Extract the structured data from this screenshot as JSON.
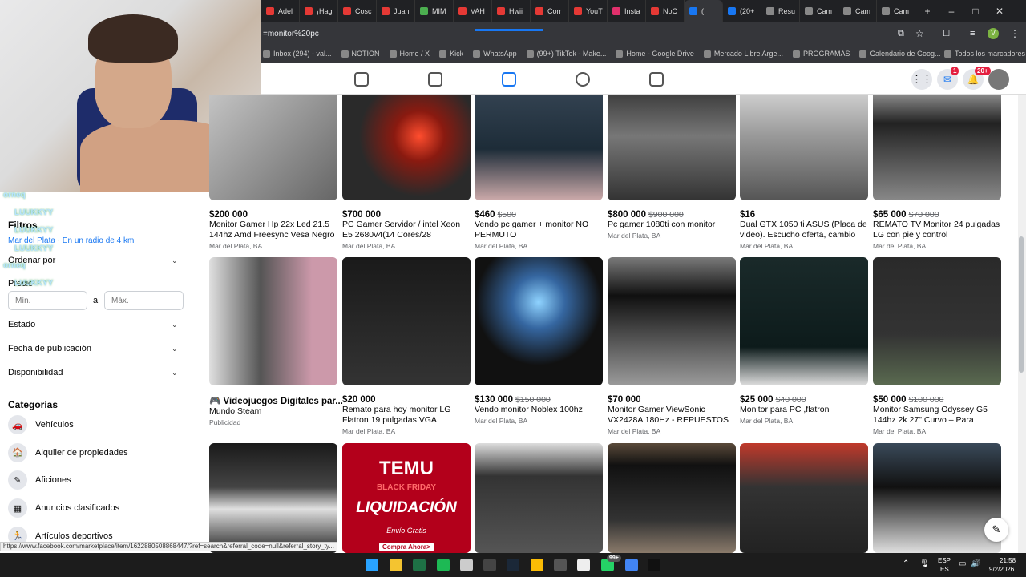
{
  "browser": {
    "tabs": [
      "Adel",
      "¡Hag",
      "Cosc",
      "Juan",
      "MIM",
      "VAH",
      "Hwii",
      "Corr",
      "YouT",
      "Insta",
      "NoC",
      "(",
      "(20+",
      "Resu",
      "Cam",
      "Cam",
      "Cam"
    ],
    "url": "=monitor%20pc",
    "bookmarks": [
      "Inbox (294) - val...",
      "NOTION",
      "Home / X",
      "Kick",
      "WhatsApp",
      "(99+) TikTok - Make...",
      "Home - Google Drive",
      "Mercado Libre Arge...",
      "PROGRAMAS",
      "Calendario de Goog..."
    ],
    "all_bookmarks": "Todos los marcadores",
    "profile_letter": "V",
    "status_url": "https://www.facebook.com/marketplace/item/1622880508868447/?ref=search&referral_code=null&referral_story_ty..."
  },
  "fbnav": {
    "messenger_badge": "1",
    "notif_badge": "20+"
  },
  "chat": {
    "user1": "orneq",
    "user2": "LUUKKYY"
  },
  "sidebar": {
    "filters": "Filtros",
    "location": "Mar del Plata · En un radio de 4 km",
    "sort": "Ordenar por",
    "price": "Precio",
    "min_placeholder": "Mín.",
    "between": "a",
    "max_placeholder": "Máx.",
    "estado": "Estado",
    "fecha": "Fecha de publicación",
    "disponibilidad": "Disponibilidad",
    "categories_title": "Categorías",
    "categories": [
      "Vehículos",
      "Alquiler de propiedades",
      "Aficiones",
      "Anuncios clasificados",
      "Artículos deportivos"
    ]
  },
  "listings": [
    {
      "price": "$200 000",
      "old": "",
      "title": "Monitor Gamer Hp 22x Led 21.5 144hz Amd Freesync Vesa Negro",
      "loc": "Mar del Plata, BA"
    },
    {
      "price": "$700 000",
      "old": "",
      "title": "PC Gamer Servidor / intel Xeon E5 2680v4(14 Cores/28 Threads),RAM...",
      "loc": "Mar del Plata, BA"
    },
    {
      "price": "$460",
      "old": "$500",
      "title": "Vendo pc gamer + monitor NO PERMUTO",
      "loc": "Mar del Plata, BA"
    },
    {
      "price": "$800 000",
      "old": "$900 000",
      "title": "Pc gamer 1080ti con monitor",
      "loc": "Mar del Plata, BA"
    },
    {
      "price": "$16",
      "old": "",
      "title": "Dual GTX 1050 ti ASUS (Placa de video). Escucho oferta, cambio por...",
      "loc": "Mar del Plata, BA"
    },
    {
      "price": "$65 000",
      "old": "$70 000",
      "title": "REMATO TV Monitor 24 pulgadas LG con pie y control",
      "loc": "Mar del Plata, BA"
    },
    {
      "price": "🎮 Videojuegos Digitales par...",
      "old": "",
      "title": "Mundo Steam",
      "loc": "Publicidad"
    },
    {
      "price": "$20 000",
      "old": "",
      "title": "Remato para hoy monitor LG Flatron 19 pulgadas VGA",
      "loc": "Mar del Plata, BA"
    },
    {
      "price": "$130 000",
      "old": "$150 000",
      "title": "Vendo monitor Noblex 100hz",
      "loc": "Mar del Plata, BA"
    },
    {
      "price": "$70 000",
      "old": "",
      "title": " Monitor Gamer ViewSonic VX2428A 180Hz - REPUESTOS",
      "loc": "Mar del Plata, BA"
    },
    {
      "price": "$25 000",
      "old": "$40 000",
      "title": "Monitor para PC ,flatron",
      "loc": "Mar del Plata, BA"
    },
    {
      "price": "$50 000",
      "old": "$100 000",
      "title": "Monitor Samsung Odyssey G5 144hz 2k 27\" Curvo – Para Reparar...",
      "loc": "Mar del Plata, BA"
    }
  ],
  "temu_ad": {
    "brand": "TEMU",
    "line1": "BLACK FRIDAY",
    "line2": "LIQUIDACIÓN",
    "line3": "Envío Gratis",
    "cta": "Compra Ahora>"
  },
  "taskbar": {
    "lang1": "ESP",
    "lang2": "ES",
    "time": "21:58",
    "date": "9/2/2026",
    "wa_badge": "99+"
  }
}
